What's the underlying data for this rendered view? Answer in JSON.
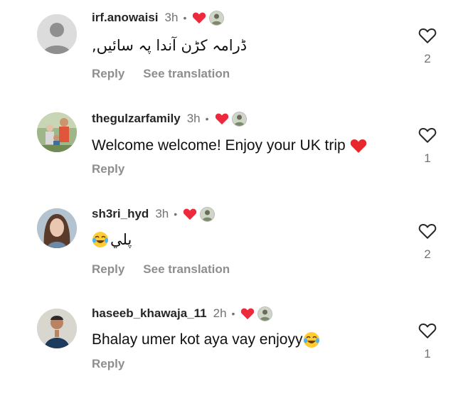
{
  "comments": [
    {
      "username": "irf.anowaisi",
      "time": "3h",
      "text": "ڈرامہ کڑن آندا پہ سائیں,",
      "reply_label": "Reply",
      "translate_label": "See translation",
      "likes": "2",
      "icons": {
        "avatar": "default-avatar-icon",
        "heart": "red-heart-icon",
        "like": "heart-outline-icon"
      }
    },
    {
      "username": "thegulzarfamily",
      "time": "3h",
      "text": "Welcome welcome! Enjoy your UK trip",
      "text_emoji": "red-heart-emoji",
      "reply_label": "Reply",
      "likes": "1"
    },
    {
      "username": "sh3ri_hyd",
      "time": "3h",
      "text": "پلي",
      "text_emoji": "tears-of-joy-emoji",
      "reply_label": "Reply",
      "translate_label": "See translation",
      "likes": "2"
    },
    {
      "username": "haseeb_khawaja_11",
      "time": "2h",
      "text": "Bhalay umer kot aya vay enjoyy",
      "text_emoji": "tears-of-joy-emoji",
      "reply_label": "Reply",
      "likes": "1"
    }
  ],
  "colors": {
    "heart": "#ed2a3c",
    "muted": "#737373",
    "username": "#262626"
  }
}
